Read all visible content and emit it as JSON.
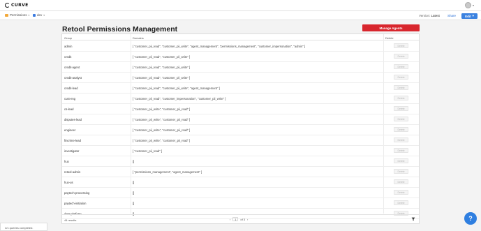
{
  "app": {
    "logo_text": "CURVE"
  },
  "breadcrumb": {
    "folder": "Permissions",
    "env": "dev"
  },
  "header": {
    "version_label": "Version:",
    "version_value": "Latest",
    "share_label": "Share",
    "edit_label": "Edit"
  },
  "page": {
    "title": "Retool Permissions Management",
    "manage_button": "Manage Agents"
  },
  "table": {
    "columns": [
      "Group",
      "Domains",
      "Delete"
    ],
    "delete_label": "Delete",
    "rows": [
      {
        "group": "admin",
        "domains": "[ \"customer_pii_read\", \"customer_pii_write\", \"agent_management\", \"permissions_management\", \"customer_impersonation\", \"admin\" ]"
      },
      {
        "group": "credit",
        "domains": "[ \"customer_pii_read\", \"customer_pii_write\" ]"
      },
      {
        "group": "credit-agent",
        "domains": "[ \"customer_pii_read\", \"customer_pii_write\" ]"
      },
      {
        "group": "credit-analyst",
        "domains": "[ \"customer_pii_read\", \"customer_pii_write\" ]"
      },
      {
        "group": "credit-lead",
        "domains": "[ \"customer_pii_read\", \"customer_pii_write\", \"agent_management\" ]"
      },
      {
        "group": "cust-eng",
        "domains": "[ \"customer_pii_read\", \"customer_impersonation\", \"customer_pii_write\" ]"
      },
      {
        "group": "cs-lead",
        "domains": "[ \"customer_pii_write\", \"customer_pii_read\" ]"
      },
      {
        "group": "disputes-lead",
        "domains": "[ \"customer_pii_write\", \"customer_pii_read\" ]"
      },
      {
        "group": "engineer",
        "domains": "[ \"customer_pii_write\", \"customer_pii_read\" ]"
      },
      {
        "group": "fincrime-lead",
        "domains": "[ \"customer_pii_write\", \"customer_pii_read\" ]"
      },
      {
        "group": "investigator",
        "domains": "[ \"customer_pii_read\" ]"
      },
      {
        "group": "hux",
        "domains": "[]"
      },
      {
        "group": "retool-admin",
        "domains": "[ \"permissions_management\", \"agent_management\" ]"
      },
      {
        "group": "hux-us",
        "domains": "[]"
      },
      {
        "group": "paytech-processing",
        "domains": "[]"
      },
      {
        "group": "paytech-initiation",
        "domains": "[]"
      },
      {
        "group": "data-platform",
        "domains": "[]"
      }
    ],
    "results_text": "44 results",
    "page_current": "1",
    "page_total_text": "of 3"
  },
  "status_text": "4/1 queries completed.",
  "help_text": "?"
}
